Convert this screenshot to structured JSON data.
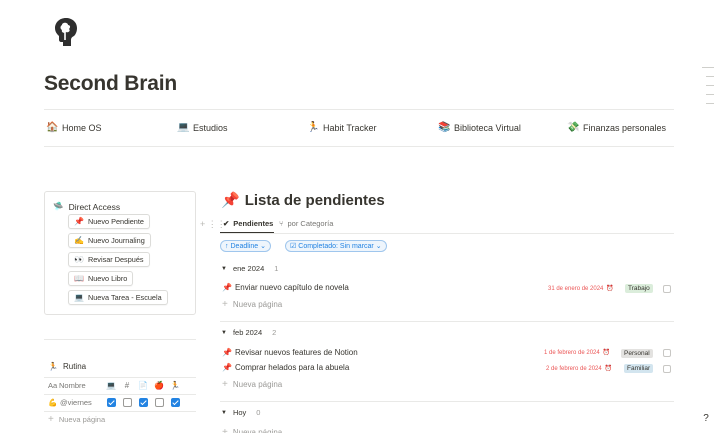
{
  "page": {
    "title": "Second Brain",
    "icon": "brain-head-icon"
  },
  "nav": [
    {
      "icon": "🏠",
      "label": "Home OS"
    },
    {
      "icon": "💻",
      "label": "Estudios"
    },
    {
      "icon": "🏃",
      "label": "Habit Tracker"
    },
    {
      "icon": "📚",
      "label": "Biblioteca Virtual"
    },
    {
      "icon": "💸",
      "label": "Finanzas personales"
    }
  ],
  "direct_access": {
    "icon": "🛸",
    "title": "Direct Access",
    "buttons": [
      {
        "icon": "📌",
        "label": "Nuevo Pendiente"
      },
      {
        "icon": "✍️",
        "label": "Nuevo Journaling"
      },
      {
        "icon": "👀",
        "label": "Revisar Después"
      },
      {
        "icon": "📖",
        "label": "Nuevo Libro"
      },
      {
        "icon": "💻",
        "label": "Nueva Tarea - Escuela"
      }
    ]
  },
  "rutina": {
    "icon": "🏃",
    "title": "Rutina",
    "name_prefix": "Aa",
    "name_header": "Nombre",
    "column_icons": [
      "💻",
      "#",
      "📄",
      "🍎",
      "🏃"
    ],
    "row": {
      "icon": "💪",
      "label": "@viernes",
      "checks": [
        true,
        false,
        true,
        false,
        true
      ]
    },
    "new_label": "Nueva página"
  },
  "tasks_db": {
    "icon": "📌",
    "title": "Lista de pendientes",
    "tabs": [
      {
        "icon": "✔",
        "label": "Pendientes",
        "active": true
      },
      {
        "icon": "⑂",
        "label": "por Categoría",
        "active": false
      }
    ],
    "filters": [
      {
        "icon": "↑",
        "label": "Deadline",
        "suffix": "⌄"
      },
      {
        "icon": "☑",
        "label": "Completado: Sin marcar",
        "suffix": "⌄"
      }
    ],
    "new_label": "Nueva página",
    "groups": [
      {
        "name": "ene 2024",
        "count": "1",
        "tasks": [
          {
            "icon": "📌",
            "title": "Enviar nuevo capítulo de novela",
            "date": "31 de enero de 2024",
            "tag": "Trabajo",
            "tag_color": "#dbeddb"
          }
        ]
      },
      {
        "name": "feb 2024",
        "count": "2",
        "tasks": [
          {
            "icon": "📌",
            "title": "Revisar nuevos features de Notion",
            "date": "1 de febrero de 2024",
            "tag": "Personal",
            "tag_color": "#e3e2e0"
          },
          {
            "icon": "📌",
            "title": "Comprar helados para la abuela",
            "date": "2 de febrero de 2024",
            "tag": "Familiar",
            "tag_color": "#d3e5ef"
          }
        ]
      },
      {
        "name": "Hoy",
        "count": "0",
        "tasks": []
      }
    ]
  },
  "colors": {
    "accent": "#2383e2",
    "deadline": "#eb5757",
    "text": "#37352f"
  }
}
